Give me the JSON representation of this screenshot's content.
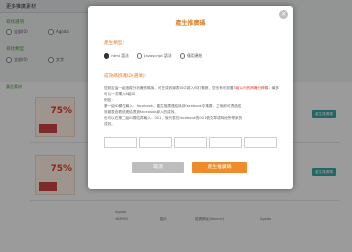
{
  "background": {
    "header_title": "更多推廣素材",
    "filter1_label": "尋找選項",
    "filter1_option1": "全部(0)",
    "filter1_option2": "Agoda",
    "filter2_label": "尋找類型",
    "filter2_option1": "全部(0)",
    "filter2_option2": "文字",
    "panel_label": "廣告素材",
    "row1_badge": "75%",
    "row2_badge": "75%",
    "row_button": "產生推廣碼",
    "footer_name": "Agoda",
    "footer_size": "468*60",
    "footer_type": "圖片",
    "footer_url": "推廣網址(Banner)",
    "footer_brand": "Agoda"
  },
  "modal": {
    "title": "產生推廣碼",
    "close_symbol": "×",
    "section1_label": "產生類型：",
    "radio_options": [
      {
        "label": "html 語法",
        "selected": true
      },
      {
        "label": "Javascript 語法",
        "selected": false
      },
      {
        "label": "僅用連結",
        "selected": false
      }
    ],
    "section2_label": "成效碼辨識ID(選填)：",
    "desc_line1_a": "您設定這一組追蹤分析識別碼後，可在成效總表ID中將入你訂素數，您也有可設置",
    "desc_line1_red": "5組以內的辨識分辨碼",
    "desc_line1_b": "，最多可以一次購入6組ID",
    "desc_line2": "例如：",
    "desc_line3": "第一組ID欄位輸入：facebook，產生推廣連結後到facebook中推廣，之後即可透過成",
    "desc_line4": "效報表查看該連結透過facebook導入的成效。",
    "desc_line5": "也可以在第二組ID欄位再輸入：001，就代表在facebook的001號文章或時段所帶來的",
    "desc_line6": "成效。",
    "cancel_label": "取消",
    "create_label": "產生推廣碼"
  }
}
